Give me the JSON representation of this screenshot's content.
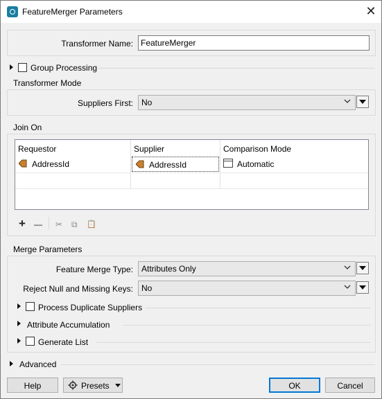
{
  "window": {
    "title": "FeatureMerger Parameters",
    "close_glyph": "✕"
  },
  "transformer_name": {
    "label": "Transformer Name:",
    "value": "FeatureMerger"
  },
  "group_processing": {
    "label": "Group Processing"
  },
  "transformer_mode": {
    "section": "Transformer Mode",
    "suppliers_first": {
      "label": "Suppliers First:",
      "value": "No"
    }
  },
  "join_on": {
    "section": "Join On",
    "columns": [
      "Requestor",
      "Supplier",
      "Comparison Mode"
    ],
    "rows": [
      {
        "requestor": "AddressId",
        "supplier": "AddressId",
        "comparison": "Automatic"
      }
    ],
    "toolbar": {
      "add": "+",
      "remove": "—",
      "cut": "✂",
      "copy": "⧉",
      "paste": "📋"
    }
  },
  "merge_parameters": {
    "section": "Merge Parameters",
    "feature_merge_type": {
      "label": "Feature Merge Type:",
      "value": "Attributes Only"
    },
    "reject_null": {
      "label": "Reject Null and Missing Keys:",
      "value": "No"
    },
    "process_duplicate_suppliers": "Process Duplicate Suppliers",
    "attribute_accumulation": "Attribute Accumulation",
    "generate_list": "Generate List"
  },
  "advanced": {
    "label": "Advanced"
  },
  "buttons": {
    "help": "Help",
    "presets": "Presets",
    "ok": "OK",
    "cancel": "Cancel"
  },
  "colors": {
    "accent": "#0078d7",
    "attribute_icon": "#c8822f"
  }
}
